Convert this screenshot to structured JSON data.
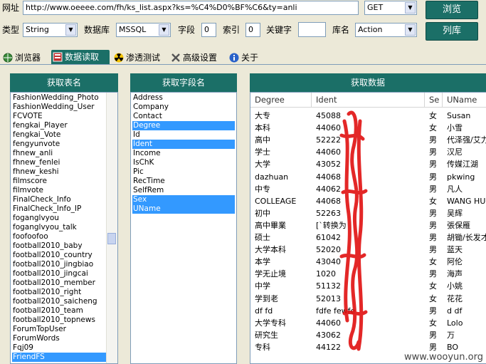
{
  "toolbar": {
    "url_label": "网址",
    "url_value": "http://www.oeeee.com/fh/ks_list.aspx?ks=%C4%D0%BF%C6&ty=anli",
    "method_value": "GET",
    "browse_button": "浏览",
    "type_label": "类型",
    "type_value": "String",
    "db_label": "数据库",
    "db_value": "MSSQL",
    "field_label": "字段",
    "field_value": "0",
    "index_label": "索引",
    "index_value": "0",
    "keyword_label": "关键字",
    "keyword_value": "",
    "dbname_label": "库名",
    "dbname_value": "Action",
    "list_db_button": "列库"
  },
  "tabs": [
    {
      "label": "浏览器",
      "icon": "globe-icon"
    },
    {
      "label": "数据读取",
      "icon": "database-icon"
    },
    {
      "label": "渗透测试",
      "icon": "radiation-icon"
    },
    {
      "label": "高级设置",
      "icon": "tools-icon"
    },
    {
      "label": "关于",
      "icon": "info-icon"
    }
  ],
  "active_tab": 1,
  "tables_panel": {
    "title": "获取表名",
    "items": [
      "FashionWedding_Photo",
      "FashionWedding_User",
      "FCVOTE",
      "fengkai_Player",
      "fengkai_Vote",
      "fengyunvote",
      "fhnew_anli",
      "fhnew_fenlei",
      "fhnew_keshi",
      "filmscore",
      "filmvote",
      "FinalCheck_Info",
      "FinalCheck_Info_IP",
      "foganglvyou",
      "foganglvyou_talk",
      "foofoofoo",
      "football2010_baby",
      "football2010_country",
      "football2010_jingbiao",
      "football2010_jingcai",
      "football2010_member",
      "football2010_right",
      "football2010_saicheng",
      "football2010_team",
      "football2010_topnews",
      "ForumTopUser",
      "ForumWords",
      "Fqj09",
      "FriendFS"
    ],
    "selected": "FriendFS"
  },
  "fields_panel": {
    "title": "获取字段名",
    "items": [
      "Address",
      "Company",
      "Contact",
      "Degree",
      "Id",
      "Ident",
      "Income",
      "IsChK",
      "Pic",
      "RecTime",
      "SelfRem",
      "Sex",
      "UName"
    ],
    "selected": [
      "Degree",
      "Ident",
      "Sex",
      "UName"
    ]
  },
  "data_panel": {
    "title": "获取数据",
    "columns": [
      "Degree",
      "Ident",
      "Se",
      "UName"
    ],
    "rows": [
      [
        "大专",
        "45088",
        "女",
        "Susan"
      ],
      [
        "本科",
        "44060",
        "女",
        "小雪"
      ],
      [
        "高中",
        "52222",
        "男",
        "代泽强/艾力"
      ],
      [
        "学士",
        "44060",
        "男",
        "汉尼"
      ],
      [
        "大学",
        "43052",
        "男",
        "传媒江湖"
      ],
      [
        "dazhuan",
        "44068",
        "男",
        "pkwing"
      ],
      [
        "中专",
        "44062",
        "男",
        "凡人"
      ],
      [
        "COLLEAGE",
        "44068",
        "女",
        "WANG HUI"
      ],
      [
        "初中",
        "52263",
        "男",
        "吴辉"
      ],
      [
        "高中畢業",
        "[`转换为",
        "男",
        "張保雁"
      ],
      [
        "硕士",
        "61042",
        "男",
        "胡锄/长发才"
      ],
      [
        "大学本科",
        "52020",
        "男",
        "蓝天"
      ],
      [
        "本学",
        "43040",
        "女",
        "阿伦"
      ],
      [
        "学无止境",
        "1020",
        "男",
        "海声"
      ],
      [
        "中学",
        "51132",
        "女",
        "小姚"
      ],
      [
        "学到老",
        "52013",
        "女",
        "花花"
      ],
      [
        "df fd",
        "fdfe fewfe",
        "男",
        "d df"
      ],
      [
        "大学专科",
        "44060",
        "女",
        "Lolo"
      ],
      [
        "研究生",
        "43062",
        "男",
        "万"
      ],
      [
        "专科",
        "44122",
        "男",
        "BO"
      ]
    ]
  },
  "watermark": "www.wooyun.org",
  "colors": {
    "accent": "#1b6f67",
    "selection": "#3399ff",
    "redaction": "#e01010"
  }
}
